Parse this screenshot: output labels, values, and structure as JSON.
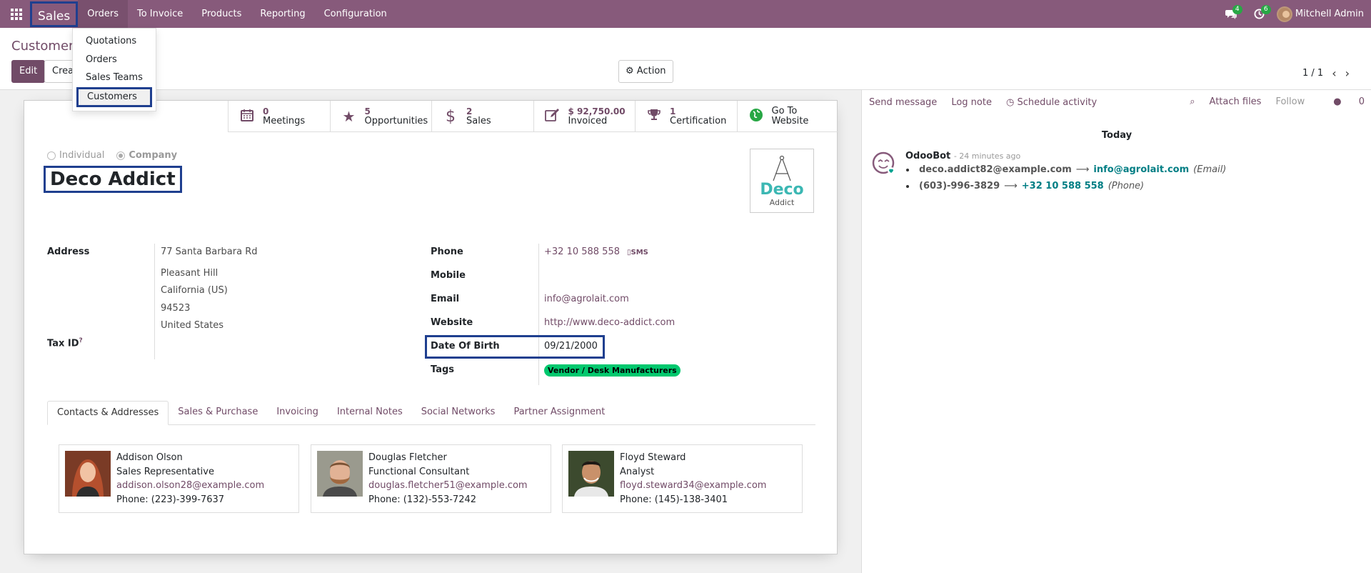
{
  "navbar": {
    "app_name": "Sales",
    "menus": [
      "Orders",
      "To Invoice",
      "Products",
      "Reporting",
      "Configuration"
    ],
    "messages_count": "4",
    "activities_count": "6",
    "user_name": "Mitchell Admin"
  },
  "orders_dropdown": [
    "Quotations",
    "Orders",
    "Sales Teams",
    "Customers"
  ],
  "control_panel": {
    "breadcrumb": "Customers",
    "edit_label": "Edit",
    "create_label": "Crea",
    "action_label": "Action",
    "pager": "1 / 1"
  },
  "stat_buttons": [
    {
      "value": "0",
      "label": "Meetings",
      "icon": "calendar-icon"
    },
    {
      "value": "5",
      "label": "Opportunities",
      "icon": "star-icon"
    },
    {
      "value": "2",
      "label": "Sales",
      "icon": "dollar-icon"
    },
    {
      "value": "$ 92,750.00",
      "label": "Invoiced",
      "icon": "edit-icon"
    },
    {
      "value": "1",
      "label": "Certification",
      "icon": "trophy-icon"
    },
    {
      "value": "Go To",
      "label": "Website",
      "icon": "globe-icon"
    }
  ],
  "partner": {
    "type_individual": "Individual",
    "type_company": "Company",
    "name": "Deco Addict",
    "logo_line1": "Deco",
    "logo_line2": "Addict"
  },
  "fields": {
    "address_label": "Address",
    "street": "77 Santa Barbara Rd",
    "city": "Pleasant Hill",
    "state": "California (US)",
    "zip": "94523",
    "country": "United States",
    "tax_id_label": "Tax ID",
    "tax_id_help": "?",
    "phone_label": "Phone",
    "phone": "+32 10 588 558",
    "sms_label": "SMS",
    "mobile_label": "Mobile",
    "email_label": "Email",
    "email": "info@agrolait.com",
    "website_label": "Website",
    "website": "http://www.deco-addict.com",
    "dob_label": "Date Of Birth",
    "dob": "09/21/2000",
    "tags_label": "Tags",
    "tag": "Vendor / Desk Manufacturers"
  },
  "tabs": [
    "Contacts & Addresses",
    "Sales & Purchase",
    "Invoicing",
    "Internal Notes",
    "Social Networks",
    "Partner Assignment"
  ],
  "contacts": [
    {
      "name": "Addison Olson",
      "title": "Sales Representative",
      "email": "addison.olson28@example.com",
      "phone": "Phone: (223)-399-7637"
    },
    {
      "name": "Douglas Fletcher",
      "title": "Functional Consultant",
      "email": "douglas.fletcher51@example.com",
      "phone": "Phone: (132)-553-7242"
    },
    {
      "name": "Floyd Steward",
      "title": "Analyst",
      "email": "floyd.steward34@example.com",
      "phone": "Phone: (145)-138-3401"
    }
  ],
  "chatter": {
    "send_message": "Send message",
    "log_note": "Log note",
    "schedule_activity": "Schedule activity",
    "attach_files": "Attach files",
    "follow": "Follow",
    "followers_count": "0",
    "today": "Today",
    "author": "OdooBot",
    "time": "- 24 minutes ago",
    "changes": [
      {
        "old": "deco.addict82@example.com",
        "new": "info@agrolait.com",
        "field": "(Email)"
      },
      {
        "old": "(603)-996-3829",
        "new": "+32 10 588 558",
        "field": "(Phone)"
      }
    ]
  },
  "colors": {
    "brand": "#875A7B",
    "primary": "#714B67",
    "highlight_box": "#1f3f8f",
    "tag_green": "#00c86e",
    "chatter_link": "#017e84"
  }
}
